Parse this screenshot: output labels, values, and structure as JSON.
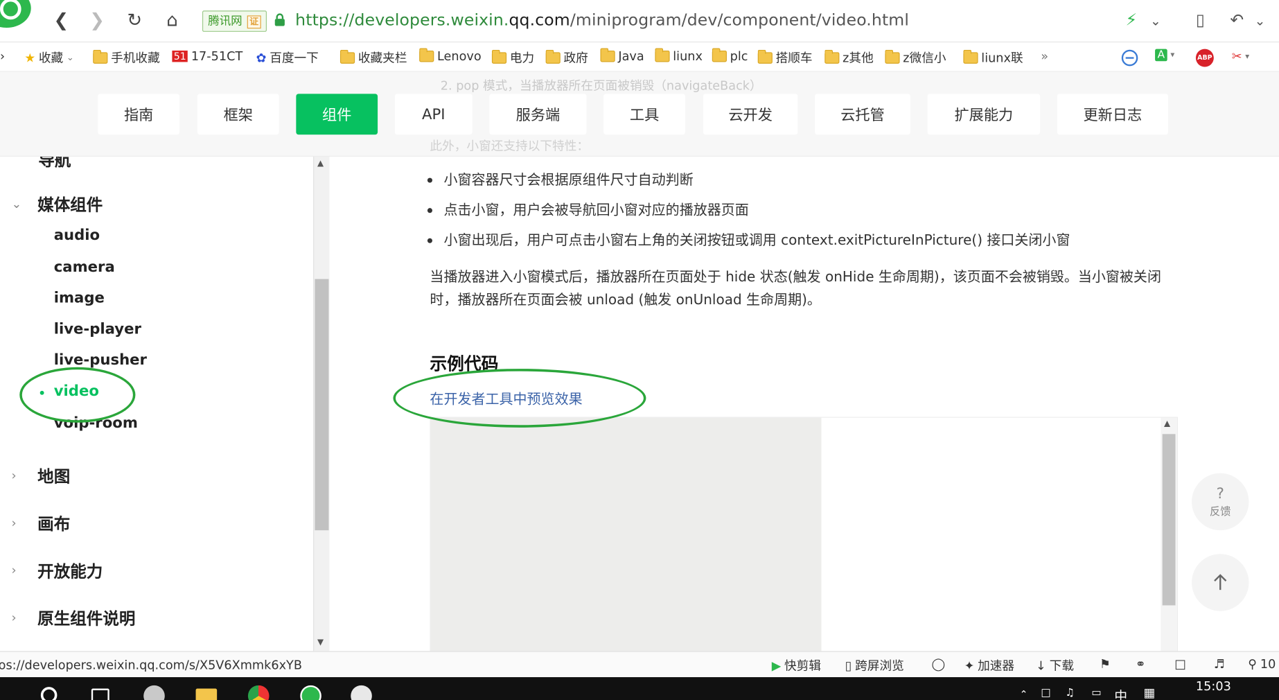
{
  "browser": {
    "security_badge": "腾讯网",
    "security_badge_mark": "证",
    "url_scheme": "https://developers.weixin.",
    "url_domain": "qq.com",
    "url_path": "/miniprogram/dev/component/video.html"
  },
  "bookmarks": [
    {
      "label": "收藏",
      "icon": "star-icon"
    },
    {
      "label": "手机收藏",
      "icon": "folder-icon"
    },
    {
      "label": "17-51CT",
      "icon": "51cto-icon"
    },
    {
      "label": "百度一下",
      "icon": "baidu-paw-icon"
    },
    {
      "label": "收藏夹栏",
      "icon": "folder-icon"
    },
    {
      "label": "Lenovo",
      "icon": "folder-icon"
    },
    {
      "label": "电力",
      "icon": "folder-icon"
    },
    {
      "label": "政府",
      "icon": "folder-icon"
    },
    {
      "label": "Java",
      "icon": "folder-icon"
    },
    {
      "label": "liunx",
      "icon": "folder-icon"
    },
    {
      "label": "plc",
      "icon": "folder-icon"
    },
    {
      "label": "搭顺车",
      "icon": "folder-icon"
    },
    {
      "label": "z其他",
      "icon": "folder-icon"
    },
    {
      "label": "z微信小",
      "icon": "folder-icon"
    },
    {
      "label": "liunx联",
      "icon": "folder-icon"
    },
    {
      "label": "»",
      "icon": ""
    }
  ],
  "nav_tabs": [
    "指南",
    "框架",
    "组件",
    "API",
    "服务端",
    "工具",
    "云开发",
    "云托管",
    "扩展能力",
    "更新日志"
  ],
  "nav_active_index": 2,
  "sidebar": {
    "cut_heading": "导航",
    "section_media": "媒体组件",
    "media_items": [
      "audio",
      "camera",
      "image",
      "live-player",
      "live-pusher",
      "video",
      "voip-room"
    ],
    "active_item": "video",
    "sections": [
      "地图",
      "画布",
      "开放能力",
      "原生组件说明"
    ]
  },
  "content": {
    "ghost_line_1": "2. pop 模式，当播放器所在页面被销毁（navigateBack）",
    "ghost_line_2": "此外，小窗还支持以下特性：",
    "bullets": [
      "小窗容器尺寸会根据原组件尺寸自动判断",
      "点击小窗，用户会被导航回小窗对应的播放器页面",
      "小窗出现后，用户可点击小窗右上角的关闭按钮或调用 context.exitPictureInPicture() 接口关闭小窗"
    ],
    "paragraph": "当播放器进入小窗模式后，播放器所在页面处于 hide 状态(触发 onHide 生命周期)，该页面不会被销毁。当小窗被关闭时，播放器所在页面会被 unload (触发 onUnload 生命周期)。",
    "section_title": "示例代码",
    "preview_link": "在开发者工具中预览效果",
    "feedback_label": "反馈",
    "feedback_glyph": "?"
  },
  "statusbar": {
    "link_url": "os://developers.weixin.qq.com/s/X5V6Xmmk6xYB",
    "items": [
      "快剪辑",
      "跨屏浏览",
      "加速器",
      "下载"
    ],
    "zoom_partial": "10"
  },
  "taskbar": {
    "clock": "15:03",
    "ime": "中"
  },
  "colors": {
    "accent": "#07c160",
    "link": "#3b63a8",
    "annotation": "#2aa63a"
  }
}
